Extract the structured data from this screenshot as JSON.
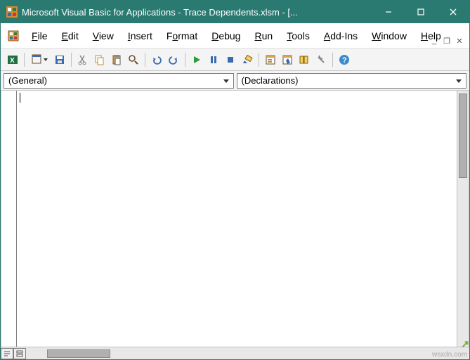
{
  "titlebar": {
    "title": "Microsoft Visual Basic for Applications - Trace Dependents.xlsm - [..."
  },
  "menu": {
    "file": "File",
    "edit": "Edit",
    "view": "View",
    "insert": "Insert",
    "format": "Format",
    "debug": "Debug",
    "run": "Run",
    "tools": "Tools",
    "addins": "Add-Ins",
    "window": "Window",
    "help": "Help"
  },
  "toolbar_icons": {
    "excel": "excel",
    "insert_form": "insert-form",
    "save": "save",
    "cut": "cut",
    "copy": "copy",
    "paste": "paste",
    "find": "find",
    "undo": "undo",
    "redo": "redo",
    "run": "run",
    "break": "break",
    "reset": "reset",
    "design": "design",
    "project": "project",
    "properties": "properties",
    "objbrowser": "object-browser",
    "toolbox": "toolbox",
    "help": "help"
  },
  "dropdowns": {
    "object": "(General)",
    "procedure": "(Declarations)"
  },
  "watermark": "wsxdn.com"
}
